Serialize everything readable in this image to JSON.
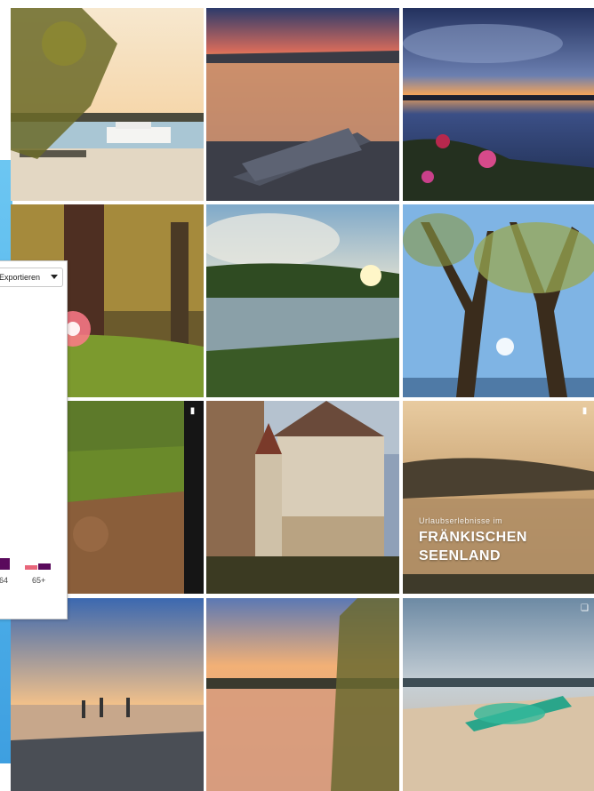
{
  "overlay": {
    "small_text": "Urlaubserlebnisse im",
    "line1": "FRÄNKISCHEN",
    "line2": "SEENLAND"
  },
  "panel": {
    "export_label": "Exportieren",
    "age_labels": [
      "64",
      "65+"
    ]
  },
  "colors": {
    "bar_dark": "#5a0a5c",
    "bar_pink": "#e8667a"
  },
  "tiles": {
    "reel_badge_icon": "reel-icon",
    "carousel_badge_icon": "carousel-icon"
  }
}
